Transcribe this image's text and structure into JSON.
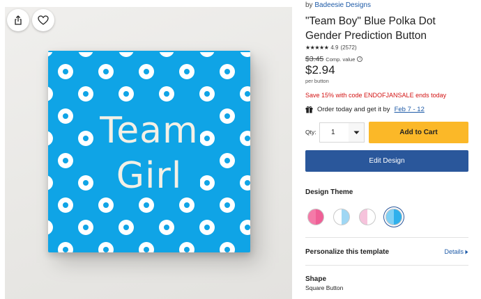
{
  "product_image": {
    "text_line1": "Team",
    "text_line2": "Girl",
    "colors": {
      "background": "#0fa4e6",
      "dots": "#ffffff",
      "text": "#f3f0e6"
    }
  },
  "actions": {
    "share_icon": "share-icon",
    "favorite_icon": "heart-icon"
  },
  "product": {
    "by_prefix": "by",
    "brand": "Badeesie Designs",
    "title": "\"Team Boy\" Blue Polka Dot Gender Prediction Button",
    "stars": "★★★★★",
    "rating": "4.9",
    "review_count": "(2572)",
    "compare_price": "$3.45",
    "compare_label": "Comp. value",
    "price": "$2.94",
    "price_unit": "per button",
    "sale_text": "Save 15% with code ENDOFJANSALE ends today",
    "delivery_text": "Order today and get it by",
    "delivery_date": "Feb 7 - 12"
  },
  "purchase": {
    "qty_label": "Qty:",
    "qty_value": "1",
    "add_to_cart": "Add to Cart",
    "edit_design": "Edit Design"
  },
  "design_theme": {
    "label": "Design Theme",
    "swatches": [
      {
        "left": "#f47aa8",
        "right": "#ef5f96",
        "selected": false
      },
      {
        "left": "#ffffff",
        "right": "#9fd7f4",
        "selected": false
      },
      {
        "left": "#f6c3dc",
        "right": "#ffffff",
        "selected": false
      },
      {
        "left": "#7fd0f5",
        "right": "#2fb0ec",
        "selected": true
      }
    ]
  },
  "personalize": {
    "label": "Personalize this template",
    "details_link": "Details"
  },
  "shape": {
    "label": "Shape",
    "value": "Square Button"
  }
}
